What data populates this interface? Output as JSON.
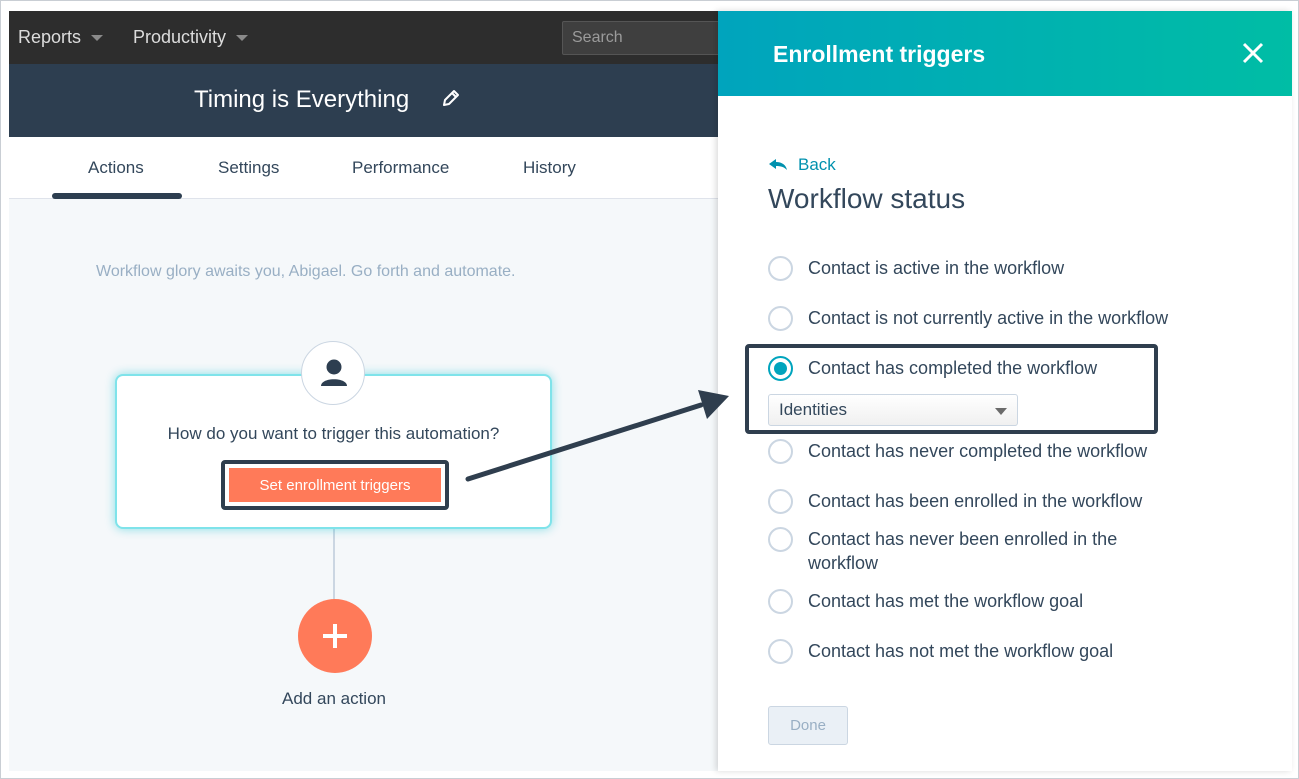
{
  "topnav": {
    "items": [
      {
        "label": "Reports"
      },
      {
        "label": "Productivity"
      }
    ],
    "search_placeholder": "Search"
  },
  "workflow": {
    "title": "Timing is Everything"
  },
  "tabs": [
    {
      "label": "Actions",
      "active": true
    },
    {
      "label": "Settings",
      "active": false
    },
    {
      "label": "Performance",
      "active": false
    },
    {
      "label": "History",
      "active": false
    }
  ],
  "canvas": {
    "greeting": "Workflow glory awaits you, Abigael. Go forth and automate.",
    "trigger_question": "How do you want to trigger this automation?",
    "enroll_button": "Set enrollment triggers",
    "add_action_label": "Add an action"
  },
  "panel": {
    "title": "Enrollment triggers",
    "back_label": "Back",
    "heading": "Workflow status",
    "options": [
      {
        "label": "Contact is active in the workflow",
        "checked": false
      },
      {
        "label": "Contact is not currently active in the workflow",
        "checked": false
      },
      {
        "label": "Contact has completed the workflow",
        "checked": true
      },
      {
        "label": "Contact has never completed the workflow",
        "checked": false
      },
      {
        "label": "Contact has been enrolled in the workflow",
        "checked": false
      },
      {
        "label": "Contact has never been enrolled in the workflow",
        "checked": false
      },
      {
        "label": "Contact has met the workflow goal",
        "checked": false
      },
      {
        "label": "Contact has not met the workflow goal",
        "checked": false
      }
    ],
    "workflow_select_value": "Identities",
    "done_label": "Done"
  },
  "colors": {
    "accent_teal": "#00a4bd",
    "cta_orange": "#ff7a59",
    "navy": "#2d3e50"
  }
}
